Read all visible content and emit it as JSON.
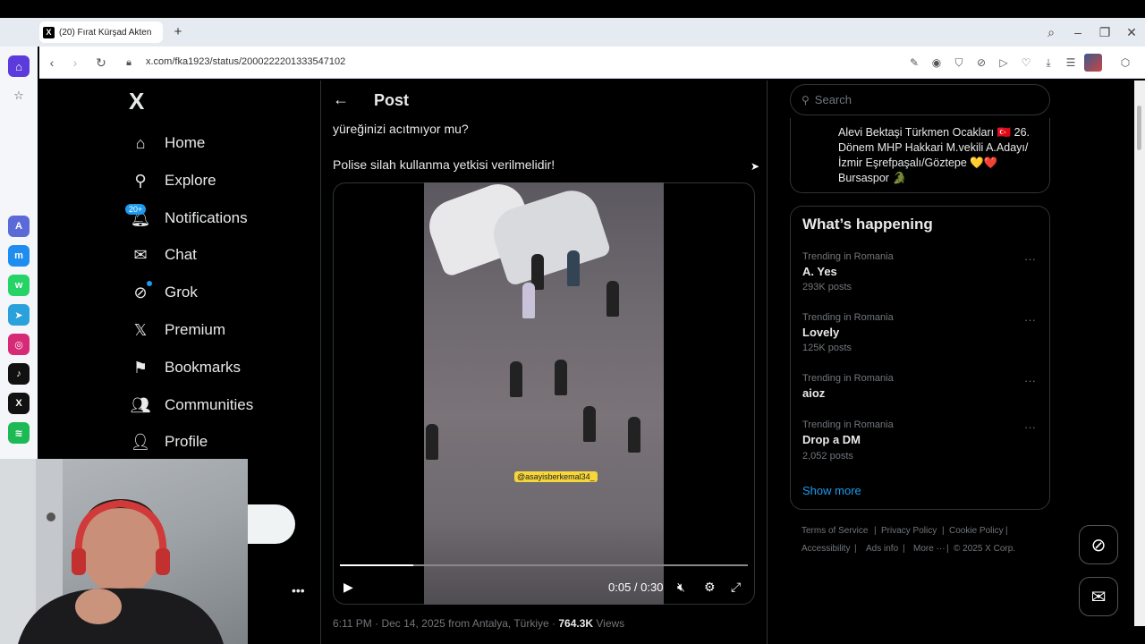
{
  "browser": {
    "tab_title": "(20) Fırat Kürşad Akten",
    "tab_favicon": "X",
    "url": "x.com/fka1923/status/2000222201333547102"
  },
  "nav": {
    "logo": "X",
    "items": [
      {
        "label": "Home",
        "icon": "home-icon"
      },
      {
        "label": "Explore",
        "icon": "search-icon"
      },
      {
        "label": "Notifications",
        "icon": "bell-icon"
      },
      {
        "label": "Chat",
        "icon": "mail-icon"
      },
      {
        "label": "Grok",
        "icon": "grok-icon"
      },
      {
        "label": "Premium",
        "icon": "x-icon"
      },
      {
        "label": "Bookmarks",
        "icon": "bookmark-icon"
      },
      {
        "label": "Communities",
        "icon": "people-icon"
      },
      {
        "label": "Profile",
        "icon": "person-icon"
      }
    ],
    "notification_badge": "20+"
  },
  "post": {
    "header_title": "Post",
    "text_line1": "yüreğinizi acıtmıyor mu?",
    "text_line2": "Polise silah kullanma yetkisi verilmelidir!",
    "video": {
      "watermark": "@asayisberkemal34_",
      "current_time": "0:05",
      "duration": "0:30",
      "time_display": "0:05 / 0:30",
      "progress": 0.18
    },
    "meta_prefix": "6:11 PM · Dec 14, 2025 from Antalya, Türkiye · ",
    "views_count": "764.3K",
    "views_label": " Views"
  },
  "sidebar": {
    "search_placeholder": "Search",
    "bio": "Alevi Bektaşi Türkmen Ocakları 🇹🇷 26. Dönem MHP Hakkari M.vekili A.Adayı/ İzmir Eşrefpaşalı/Göztepe 💛❤️ Bursaspor 🐊",
    "happening_title": "What’s happening",
    "trends": [
      {
        "context": "Trending in Romania",
        "name": "A. Yes",
        "count": "293K posts"
      },
      {
        "context": "Trending in Romania",
        "name": "Lovely",
        "count": "125K posts"
      },
      {
        "context": "Trending in Romania",
        "name": "aioz",
        "count": ""
      },
      {
        "context": "Trending in Romania",
        "name": "Drop a DM",
        "count": "2,052 posts"
      }
    ],
    "show_more": "Show more",
    "footer": {
      "terms": "Terms of Service",
      "privacy": "Privacy Policy",
      "cookie": "Cookie Policy",
      "accessibility": "Accessibility",
      "ads": "Ads info",
      "more": "More ···",
      "copyright": "© 2025 X Corp."
    }
  },
  "colors": {
    "accent": "#1d9bf0",
    "background": "#000000",
    "text": "#e7e9ea",
    "muted": "#71767b",
    "border": "#2f3336"
  }
}
